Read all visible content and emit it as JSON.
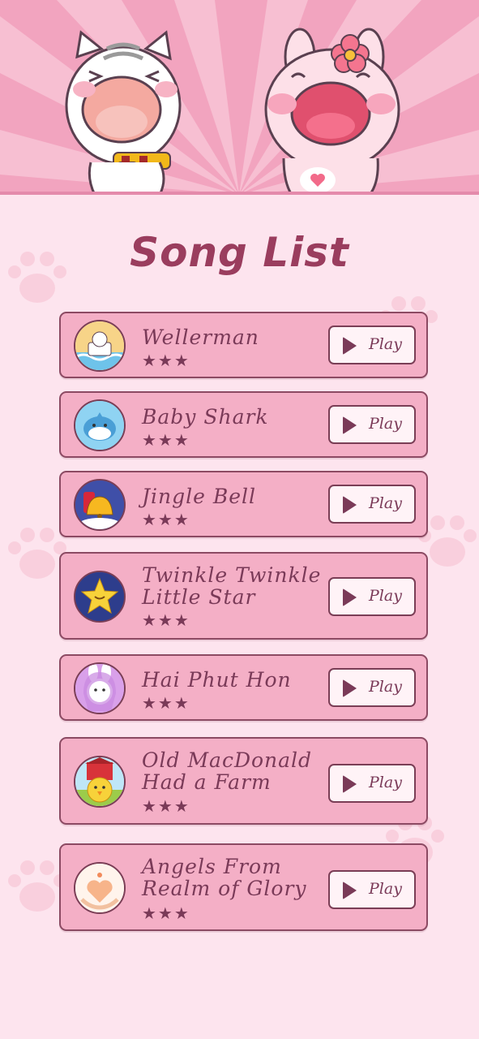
{
  "title": "Song List",
  "colors": {
    "background": "#fde4ee",
    "card": "#f4afc6",
    "card_border": "#8c4a63",
    "text": "#7a3a58",
    "title": "#9a3d5e",
    "button": "#fff3f7"
  },
  "songs": [
    {
      "title_line1": "Wellerman",
      "title_line2": "",
      "stars": "★★★",
      "play_label": "Play",
      "thumb": "cat-boat-thumbnail",
      "rating": 3
    },
    {
      "title_line1": "Baby Shark",
      "title_line2": "",
      "stars": "★★★",
      "play_label": "Play",
      "thumb": "shark-thumbnail",
      "rating": 3
    },
    {
      "title_line1": "Jingle Bell",
      "title_line2": "",
      "stars": "★★★",
      "play_label": "Play",
      "thumb": "bell-thumbnail",
      "rating": 3
    },
    {
      "title_line1": "Twinkle Twinkle",
      "title_line2": "Little Star",
      "stars": "★★★",
      "play_label": "Play",
      "thumb": "star-thumbnail",
      "rating": 3
    },
    {
      "title_line1": "Hai Phut Hon",
      "title_line2": "",
      "stars": "★★★",
      "play_label": "Play",
      "thumb": "bunny-girl-thumbnail",
      "rating": 3
    },
    {
      "title_line1": "Old MacDonald",
      "title_line2": "Had a Farm",
      "stars": "★★★",
      "play_label": "Play",
      "thumb": "chick-farm-thumbnail",
      "rating": 3
    },
    {
      "title_line1": "Angels From",
      "title_line2": "Realm of Glory",
      "stars": "★★★",
      "play_label": "Play",
      "thumb": "heart-hands-thumbnail",
      "rating": 3
    }
  ]
}
